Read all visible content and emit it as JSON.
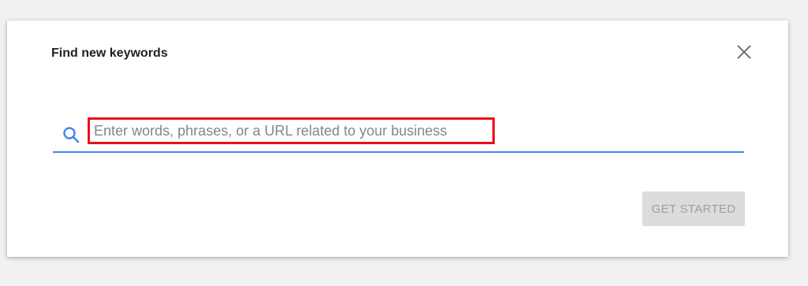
{
  "dialog": {
    "title": "Find new keywords",
    "close_icon": "close-icon"
  },
  "search": {
    "icon": "search-icon",
    "placeholder": "Enter words, phrases, or a URL related to your business",
    "value": ""
  },
  "actions": {
    "get_started_label": "GET STARTED",
    "get_started_disabled": true
  },
  "colors": {
    "accent": "#4285f4",
    "highlight_border": "#e8101b",
    "button_disabled_bg": "#dcdcdc",
    "button_disabled_text": "#9e9e9e",
    "page_bg": "#f1f1f1"
  }
}
